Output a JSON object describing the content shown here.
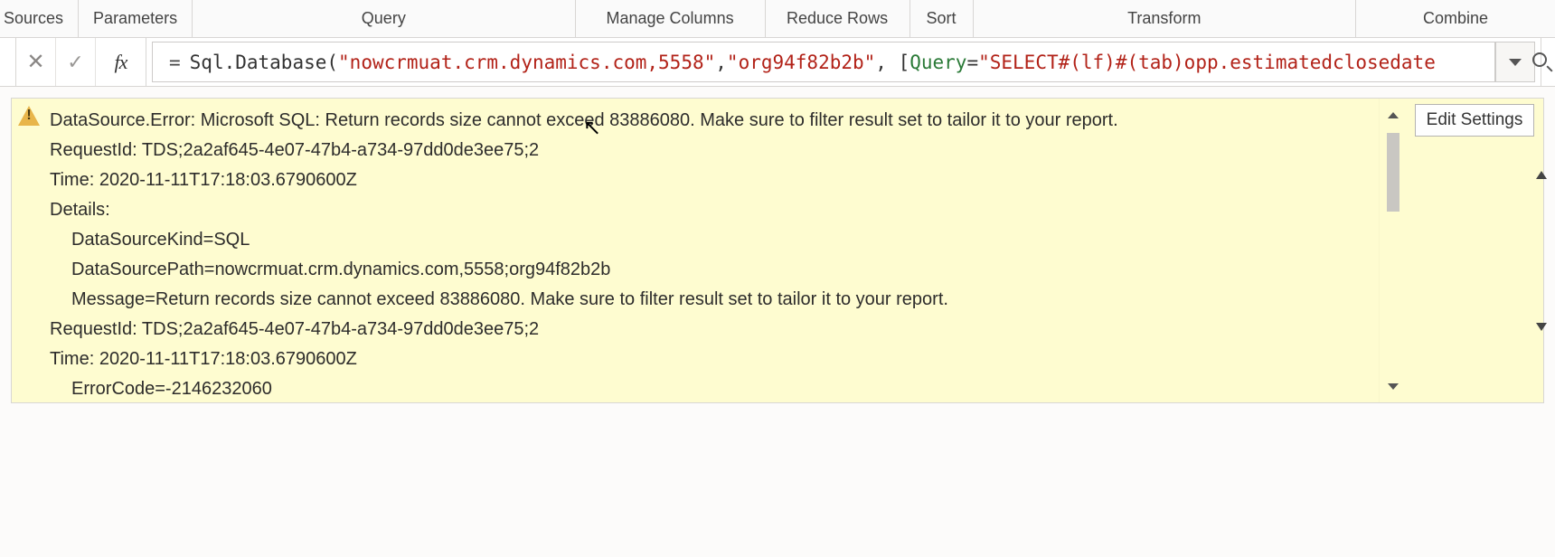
{
  "ribbon": {
    "sources": "Sources",
    "parameters": "Parameters",
    "query": "Query",
    "manage_columns": "Manage Columns",
    "reduce_rows": "Reduce Rows",
    "sort": "Sort",
    "transform": "Transform",
    "combine": "Combine"
  },
  "formula": {
    "fx_label": "fx",
    "eq": "=",
    "func": "Sql.Database(",
    "arg1": "\"nowcrmuat.crm.dynamics.com,5558\"",
    "sep1": ", ",
    "arg2": "\"org94f82b2b\"",
    "sep2": ", [",
    "key": "Query",
    "sep3": "=",
    "select_str": "\"SELECT#(lf)#(tab)opp.estimatedclosedate"
  },
  "error": {
    "line1": "DataSource.Error: Microsoft SQL: Return records size cannot exceed 83886080. Make sure to filter result set to tailor it to your report.",
    "line2": "RequestId: TDS;2a2af645-4e07-47b4-a734-97dd0de3ee75;2",
    "line3": "Time: 2020-11-11T17:18:03.6790600Z",
    "line4": "Details:",
    "line5": "DataSourceKind=SQL",
    "line6": "DataSourcePath=nowcrmuat.crm.dynamics.com,5558;org94f82b2b",
    "line7": "Message=Return records size cannot exceed 83886080. Make sure to filter result set to tailor it to your report.",
    "line8": "RequestId: TDS;2a2af645-4e07-47b4-a734-97dd0de3ee75;2",
    "line9": "Time: 2020-11-11T17:18:03.6790600Z",
    "line10": "ErrorCode=-2146232060",
    "edit_settings": "Edit Settings"
  }
}
